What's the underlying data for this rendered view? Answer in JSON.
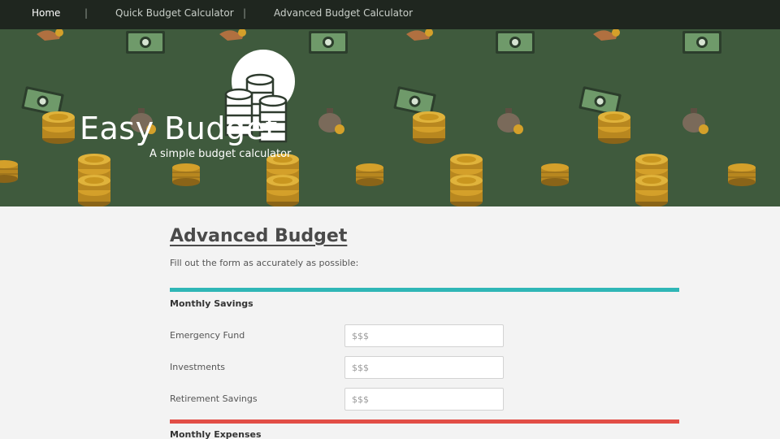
{
  "nav": {
    "items": [
      {
        "label": "Home",
        "active": true
      },
      {
        "label": "Quick Budget Calculator",
        "active": false
      },
      {
        "label": "Advanced Budget Calculator",
        "active": false
      }
    ],
    "separator": "|"
  },
  "hero": {
    "brand": "Easy Budget",
    "tagline": "A simple budget calculator",
    "background_color": "#3f5a3d",
    "pattern_icons": [
      "money-bill-icon",
      "coin-stack-icon",
      "money-bag-icon",
      "hand-coin-icon"
    ]
  },
  "main": {
    "title": "Advanced Budget",
    "description": "Fill out the form as accurately as possible:",
    "sections": [
      {
        "title": "Monthly Savings",
        "accent_color": "#2fb6b6",
        "fields": [
          {
            "label": "Emergency Fund",
            "placeholder": "$$$",
            "value": ""
          },
          {
            "label": "Investments",
            "placeholder": "$$$",
            "value": ""
          },
          {
            "label": "Retirement Savings",
            "placeholder": "$$$",
            "value": ""
          }
        ]
      },
      {
        "title": "Monthly Expenses",
        "accent_color": "#e24e46",
        "fields": []
      }
    ]
  }
}
